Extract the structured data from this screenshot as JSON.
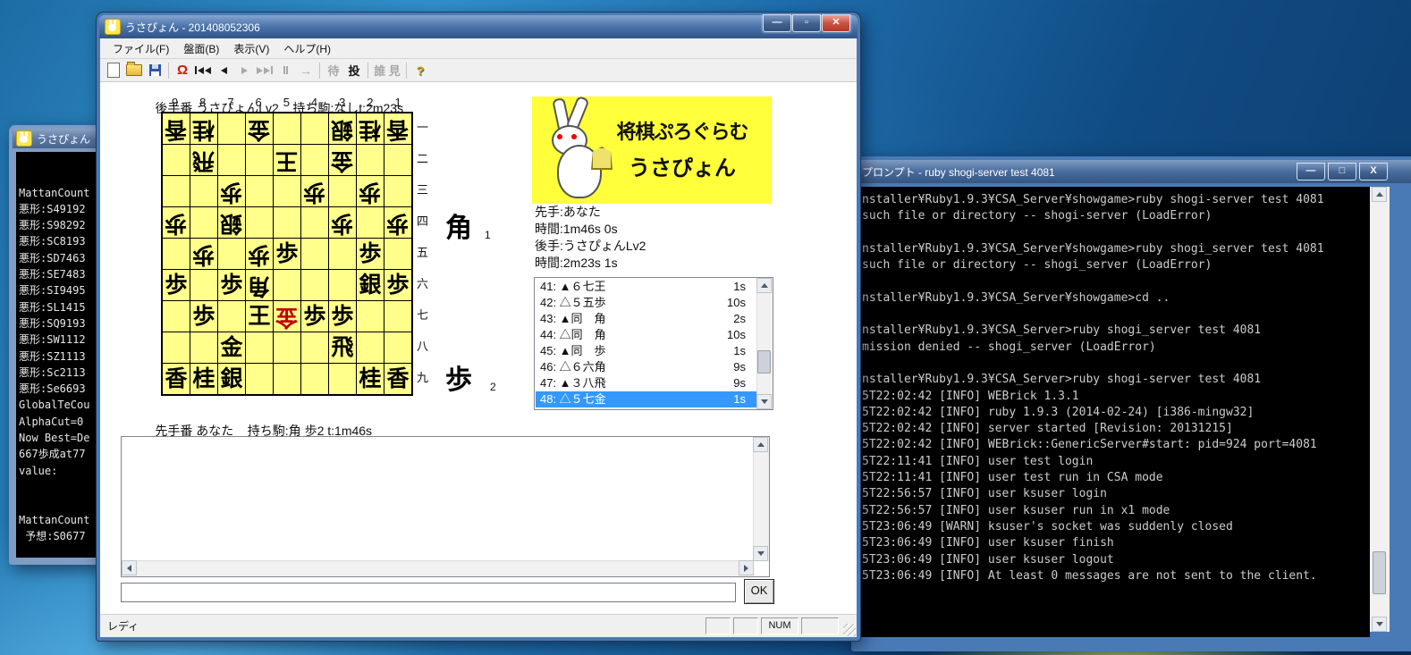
{
  "colors": {
    "board_yellow": "#ffff8b",
    "banner_yellow": "#ffff3c",
    "last_move_red": "#c00000",
    "selection_blue": "#3399ff",
    "titlebar_blue": "#4d77ad",
    "close_button_red": "#cc5142"
  },
  "main_window": {
    "title": "うさぴょん - 201408052306",
    "menu": [
      "ファイル(F)",
      "盤面(B)",
      "表示(V)",
      "ヘルプ(H)"
    ],
    "toolbar": {
      "undo": "Ω",
      "matta": "待",
      "resign": "投",
      "observe": "誰 見",
      "help": "?"
    },
    "board": {
      "top_label": "後手番 うさぴょんLv2",
      "top_hand": "持ち駒:なしt:2m23s",
      "bottom_label": "先手番 あなた",
      "bottom_hand": "持ち駒:角 歩2 t:1m46s",
      "col_labels": [
        "9",
        "8",
        "7",
        "6",
        "5",
        "4",
        "3",
        "2",
        "1"
      ],
      "row_labels": [
        "一",
        "二",
        "三",
        "四",
        "五",
        "六",
        "七",
        "八",
        "九"
      ],
      "cells": [
        [
          "香g",
          "桂g",
          "",
          "金g",
          "",
          "",
          "銀g",
          "桂g",
          "香g"
        ],
        [
          "",
          "飛g",
          "",
          "",
          "王g",
          "",
          "金g",
          "",
          ""
        ],
        [
          "",
          "",
          "歩g",
          "",
          "",
          "歩g",
          "",
          "歩g",
          ""
        ],
        [
          "歩g",
          "",
          "銀g",
          "",
          "",
          "",
          "歩g",
          "",
          "歩g"
        ],
        [
          "",
          "歩g",
          "",
          "歩g",
          "歩s",
          "",
          "",
          "歩s",
          ""
        ],
        [
          "歩s",
          "",
          "歩s",
          "角g",
          "",
          "",
          "",
          "銀s",
          "歩s"
        ],
        [
          "",
          "歩s",
          "",
          "王s",
          "金gR",
          "歩s",
          "歩s",
          "",
          ""
        ],
        [
          "",
          "",
          "金s",
          "",
          "",
          "",
          "飛s",
          "",
          ""
        ],
        [
          "香s",
          "桂s",
          "銀s",
          "",
          "",
          "",
          "",
          "桂s",
          "香s"
        ]
      ],
      "sente_hand": [
        {
          "piece": "角",
          "count": "1"
        },
        {
          "piece": "歩",
          "count": "2"
        }
      ]
    },
    "banner": {
      "line1": "将棋ぷろぐらむ",
      "line2": "うさぴょん"
    },
    "info_lines": [
      "先手:あなた",
      "時間:1m46s 0s",
      "後手:うさぴょんLv2",
      "時間:2m23s 1s"
    ],
    "moves": [
      {
        "text": "41: ▲６七王",
        "time": "1s",
        "selected": false
      },
      {
        "text": "42: △５五歩",
        "time": "10s",
        "selected": false
      },
      {
        "text": "43: ▲同　角",
        "time": "2s",
        "selected": false
      },
      {
        "text": "44: △同　角",
        "time": "10s",
        "selected": false
      },
      {
        "text": "45: ▲同　歩",
        "time": "1s",
        "selected": false
      },
      {
        "text": "46: △６六角",
        "time": "9s",
        "selected": false
      },
      {
        "text": "47: ▲３八飛",
        "time": "9s",
        "selected": false
      },
      {
        "text": "48: △５七金",
        "time": "1s",
        "selected": true
      }
    ],
    "ok_label": "OK",
    "status": {
      "ready": "レディ",
      "num": "NUM"
    }
  },
  "left_window": {
    "title": "うさぴょん",
    "lines": [
      "",
      "",
      "MattanCount",
      "悪形:S49192",
      "悪形:S98292",
      "悪形:SC8193",
      "悪形:SD7463",
      "悪形:SE7483",
      "悪形:SI9495",
      "悪形:SL1415",
      "悪形:SQ9193",
      "悪形:SW1112",
      "悪形:SZ1113",
      "悪形:Sc2113",
      "悪形:Se6693",
      "GlobalTeCou",
      "AlphaCut=0",
      "Now Best=De",
      "667歩成at77",
      "value:",
      "",
      "",
      "MattanCount",
      " 予想:S0677"
    ]
  },
  "terminal_window": {
    "title": "プロンプト - ruby  shogi-server test 4081",
    "lines": [
      "nstaller¥Ruby1.9.3¥CSA_Server¥showgame>ruby shogi-server test 4081",
      "such file or directory -- shogi-server (LoadError)",
      "",
      "nstaller¥Ruby1.9.3¥CSA_Server¥showgame>ruby shogi_server test 4081",
      "such file or directory -- shogi_server (LoadError)",
      "",
      "nstaller¥Ruby1.9.3¥CSA_Server¥showgame>cd ..",
      "",
      "nstaller¥Ruby1.9.3¥CSA_Server>ruby shogi_server test 4081",
      "mission denied -- shogi_server (LoadError)",
      "",
      "nstaller¥Ruby1.9.3¥CSA_Server>ruby shogi-server test 4081",
      "5T22:02:42 [INFO] WEBrick 1.3.1",
      "5T22:02:42 [INFO] ruby 1.9.3 (2014-02-24) [i386-mingw32]",
      "5T22:02:42 [INFO] server started [Revision: 20131215]",
      "5T22:02:42 [INFO] WEBrick::GenericServer#start: pid=924 port=4081",
      "5T22:11:41 [INFO] user test login",
      "5T22:11:41 [INFO] user test run in CSA mode",
      "5T22:56:57 [INFO] user ksuser login",
      "5T22:56:57 [INFO] user ksuser run in x1 mode",
      "5T23:06:49 [WARN] ksuser's socket was suddenly closed",
      "5T23:06:49 [INFO] user ksuser finish",
      "5T23:06:49 [INFO] user ksuser logout",
      "5T23:06:49 [INFO] At least 0 messages are not sent to the client."
    ]
  }
}
